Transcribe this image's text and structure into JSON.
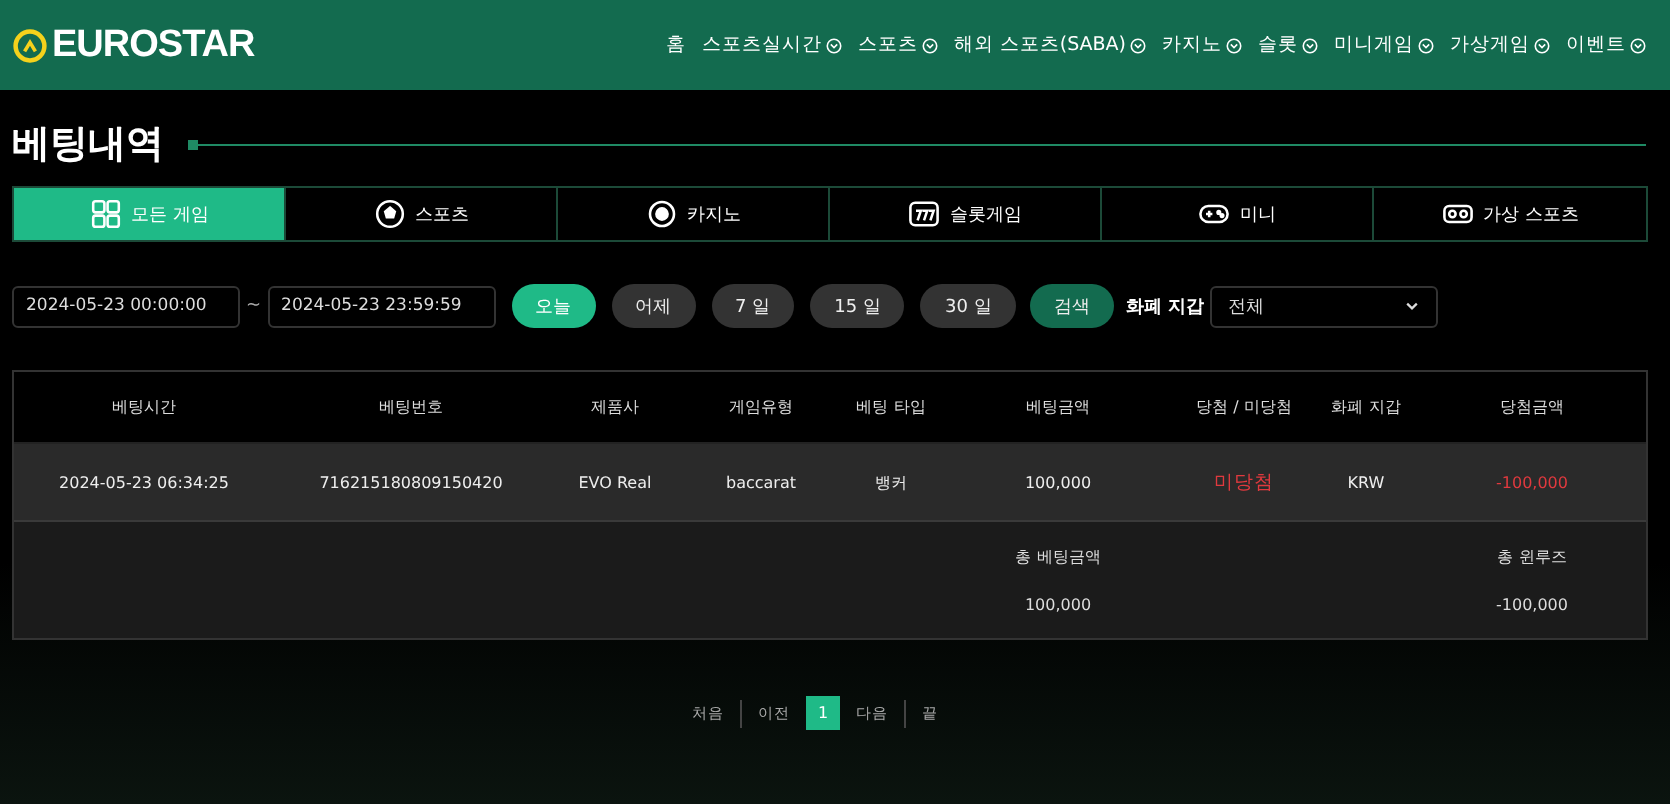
{
  "header": {
    "logo": "EUROSTAR",
    "nav": [
      {
        "label": "홈",
        "dropdown": false
      },
      {
        "label": "스포츠실시간",
        "dropdown": true
      },
      {
        "label": "스포츠",
        "dropdown": true
      },
      {
        "label": "해외 스포츠(SABA)",
        "dropdown": true
      },
      {
        "label": "카지노",
        "dropdown": true
      },
      {
        "label": "슬롯",
        "dropdown": true
      },
      {
        "label": "미니게임",
        "dropdown": true
      },
      {
        "label": "가상게임",
        "dropdown": true
      },
      {
        "label": "이벤트",
        "dropdown": true
      }
    ]
  },
  "page_title": "베팅내역",
  "tabs": [
    {
      "label": "모든 게임",
      "kind": "grid",
      "selected": true
    },
    {
      "label": "스포츠",
      "kind": "ball",
      "selected": false
    },
    {
      "label": "카지노",
      "kind": "chip",
      "selected": false
    },
    {
      "label": "슬롯게임",
      "kind": "slot",
      "selected": false
    },
    {
      "label": "미니",
      "kind": "gamepad",
      "selected": false
    },
    {
      "label": "가상 스포츠",
      "kind": "vr",
      "selected": false
    }
  ],
  "filters": {
    "date_from": "2024-05-23 00:00:00",
    "separator": "~",
    "date_to": "2024-05-23 23:59:59",
    "ranges": [
      {
        "label": "오늘",
        "selected": true
      },
      {
        "label": "어제",
        "selected": false
      },
      {
        "label": "7 일",
        "selected": false
      },
      {
        "label": "15 일",
        "selected": false
      },
      {
        "label": "30 일",
        "selected": false
      }
    ],
    "search_button": "검색",
    "wallet_label": "화폐 지갑",
    "wallet_value": "전체"
  },
  "table": {
    "columns": [
      "베팅시간",
      "베팅번호",
      "제품사",
      "게임유형",
      "베팅 타입",
      "베팅금액",
      "당첨 / 미당첨",
      "화폐 지갑",
      "당첨금액"
    ],
    "rows": [
      {
        "cells": [
          "2024-05-23 06:34:25",
          "716215180809150420",
          "EVO Real",
          "baccarat",
          "뱅커",
          "100,000",
          "미당첨",
          "KRW",
          "-100,000"
        ],
        "won": false
      }
    ],
    "summary": {
      "total_bet_label": "총 베팅금액",
      "total_bet": "100,000",
      "total_win_label": "총 윈루즈",
      "total_win": "-100,000"
    }
  },
  "pagination": {
    "first": "처음",
    "prev": "이전",
    "pages": [
      {
        "label": "1",
        "selected": true
      }
    ],
    "next": "다음",
    "last": "끝"
  }
}
